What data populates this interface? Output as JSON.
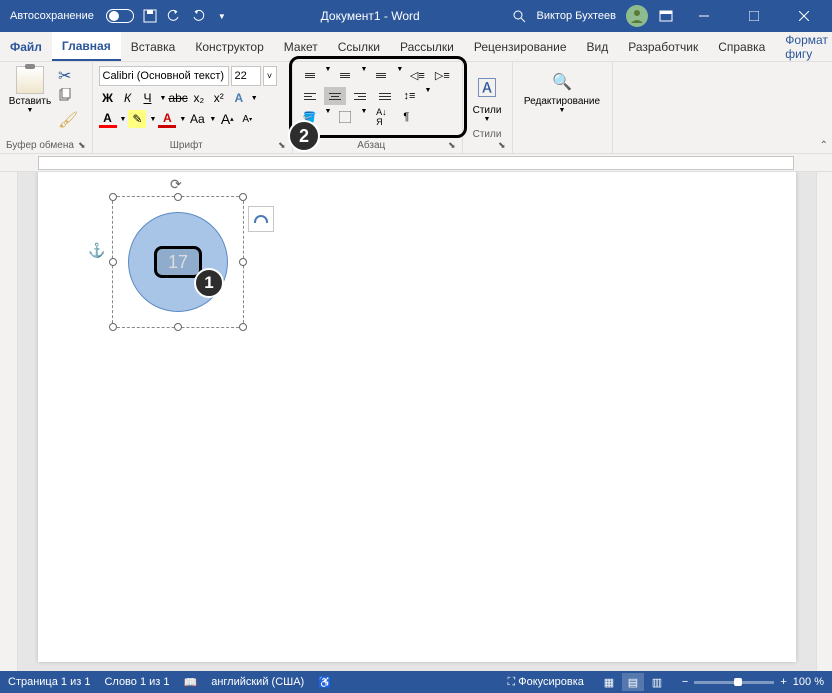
{
  "titlebar": {
    "autosave": "Автосохранение",
    "doc_title": "Документ1 - Word",
    "user": "Виктор Бухтеев"
  },
  "tabs": {
    "file": "Файл",
    "home": "Главная",
    "insert": "Вставка",
    "design": "Конструктор",
    "layout": "Макет",
    "references": "Ссылки",
    "mailings": "Рассылки",
    "review": "Рецензирование",
    "view": "Вид",
    "developer": "Разработчик",
    "help": "Справка",
    "format": "Формат фигу"
  },
  "ribbon": {
    "clipboard": {
      "paste": "Вставить",
      "label": "Буфер обмена"
    },
    "font": {
      "label": "Шрифт",
      "name": "Calibri (Основной текст)",
      "size": "22",
      "bold": "Ж",
      "italic": "К",
      "underline": "Ч",
      "strike": "abc",
      "sub": "x₂",
      "sup": "x²",
      "caseBtn": "Aa",
      "bigA": "A",
      "smallA": "A"
    },
    "paragraph": {
      "label": "Абзац"
    },
    "styles": {
      "label": "Стили",
      "btn": "Стили"
    },
    "editing": {
      "label": "",
      "btn": "Редактирование"
    }
  },
  "shape": {
    "text": "17"
  },
  "callouts": {
    "one": "1",
    "two": "2"
  },
  "status": {
    "page": "Страница 1 из 1",
    "words": "Слово 1 из 1",
    "lang": "английский (США)",
    "focus": "Фокусировка",
    "zoom": "100 %"
  }
}
